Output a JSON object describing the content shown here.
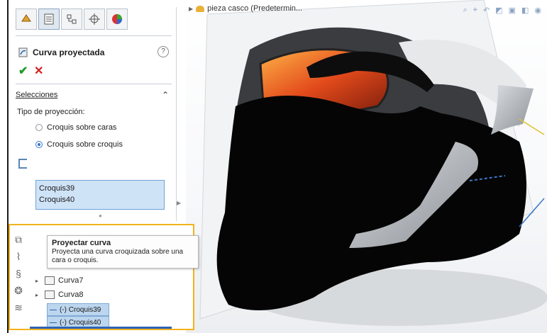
{
  "propertymanager": {
    "tabs": [
      {
        "name": "feature-manager",
        "icon": "feature-manager-icon",
        "active": false
      },
      {
        "name": "property-manager",
        "icon": "property-manager-icon",
        "active": true
      },
      {
        "name": "configuration-manager",
        "icon": "configuration-manager-icon",
        "active": false
      },
      {
        "name": "dimxpert",
        "icon": "dimxpert-icon",
        "active": false
      },
      {
        "name": "display-manager",
        "icon": "display-manager-icon",
        "active": false
      }
    ],
    "title": "Curva proyectada",
    "help_symbol": "?",
    "section_label": "Selecciones",
    "projection_label": "Tipo de proyección:",
    "options": [
      {
        "label": "Croquis sobre caras",
        "selected": false
      },
      {
        "label": "Croquis sobre croquis",
        "selected": true
      }
    ],
    "selection_items": [
      "Croquis39",
      "Croquis40"
    ]
  },
  "viewport": {
    "part_title": "pieza casco  (Predetermin..."
  },
  "tooltip": {
    "title": "Proyectar curva",
    "description": "Proyecta una curva croquizada sobre una cara o croquis."
  },
  "tree": {
    "items": [
      {
        "label": "Curva7",
        "expandable": true
      },
      {
        "label": "Curva8",
        "expandable": true
      }
    ],
    "sketches": [
      "(-) Croquis39",
      "(-) Croquis40"
    ]
  },
  "colors": {
    "highlight_border": "#f2b21c",
    "selection_fill": "#cfe3f7",
    "accent_blue": "#3b78c8"
  }
}
